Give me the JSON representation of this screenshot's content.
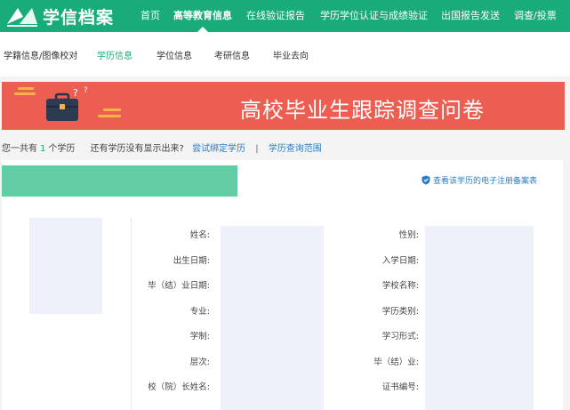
{
  "brand": {
    "logo_text": "学信档案"
  },
  "nav": {
    "items": [
      {
        "label": "首页"
      },
      {
        "label": "高等教育信息"
      },
      {
        "label": "在线验证报告"
      },
      {
        "label": "学历学位认证与成绩验证"
      },
      {
        "label": "出国报告发送"
      },
      {
        "label": "调查/投票"
      }
    ],
    "active_index": 1
  },
  "subnav": {
    "items": [
      {
        "label": "学籍信息/图像校对"
      },
      {
        "label": "学历信息"
      },
      {
        "label": "学位信息"
      },
      {
        "label": "考研信息"
      },
      {
        "label": "毕业去向"
      }
    ],
    "active_index": 1
  },
  "banner": {
    "title": "高校毕业生跟踪调查问卷"
  },
  "summary": {
    "prefix": "您一共有",
    "count": "1",
    "suffix": "个学历",
    "question": "还有学历没有显示出来?",
    "bind_link": "尝试绑定学历",
    "separator": "|",
    "range_link": "学历查询范围"
  },
  "record": {
    "link_label": "查看该学历的电子注册备案表"
  },
  "fields_left": [
    {
      "label": "姓名:"
    },
    {
      "label": "出生日期:"
    },
    {
      "label": "毕（结）业日期:"
    },
    {
      "label": "专业:"
    },
    {
      "label": "学制:"
    },
    {
      "label": "层次:"
    },
    {
      "label": "校（院）长姓名:"
    }
  ],
  "fields_right": [
    {
      "label": "性别:"
    },
    {
      "label": "入学日期:"
    },
    {
      "label": "学校名称:"
    },
    {
      "label": "学历类别:"
    },
    {
      "label": "学习形式:"
    },
    {
      "label": "毕（结）业:"
    },
    {
      "label": "证书编号:"
    }
  ],
  "colors": {
    "brand_green": "#1aab7a",
    "banner_red": "#ec5d52",
    "link_blue": "#2b7cc7",
    "tab_green": "#64cca5"
  }
}
